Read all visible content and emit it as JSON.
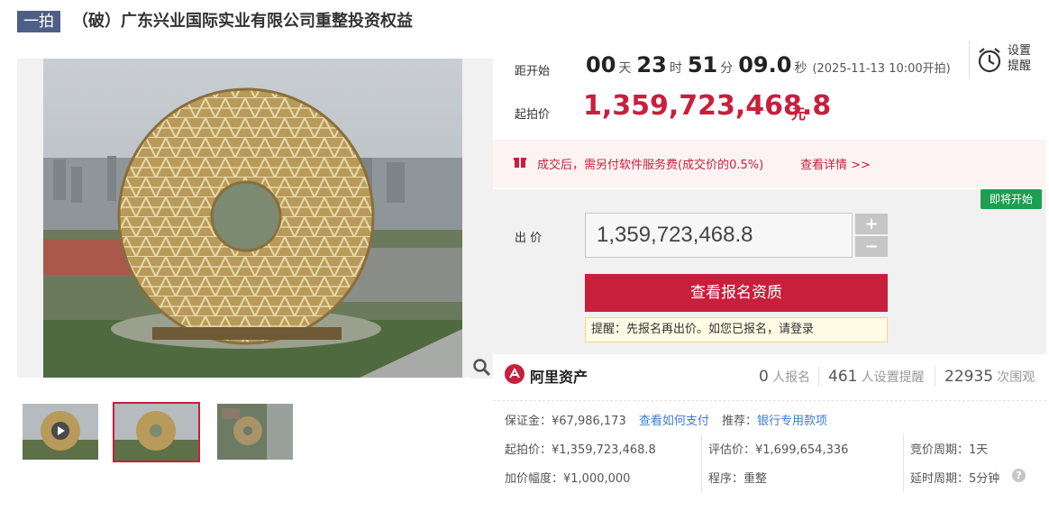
{
  "header": {
    "tag": "一拍",
    "title": "（破）广东兴业国际实业有限公司重整投资权益"
  },
  "countdown": {
    "label": "距开始",
    "days": "00",
    "days_unit": "天",
    "hours": "23",
    "hours_unit": "时",
    "minutes": "51",
    "minutes_unit": "分",
    "seconds": "09.0",
    "seconds_unit": "秒",
    "start_note": "(2025-11-13 10:00开拍)"
  },
  "reminder": {
    "label": "设置提醒"
  },
  "start_price": {
    "label": "起拍价",
    "value": "1,359,723,468.8",
    "unit": "元"
  },
  "notice": {
    "text": "成交后，需另付软件服务费(成交价的0.5%)",
    "link": "查看详情 >>"
  },
  "bid": {
    "badge": "即将开始",
    "label": "出 价",
    "value": "1,359,723,468.8",
    "plus": "+",
    "minus": "−",
    "signup_button": "查看报名资质",
    "tip": "提醒：先报名再出价。如您已报名，请登录"
  },
  "platform": {
    "name": "阿里资产"
  },
  "stats": [
    {
      "num": "0",
      "label": "人报名"
    },
    {
      "num": "461",
      "label": "人设置提醒"
    },
    {
      "num": "22935",
      "label": "次围观"
    }
  ],
  "details": {
    "deposit_label": "保证金：",
    "deposit_value": "¥67,986,173",
    "deposit_link": "查看如何支付",
    "recommend_label": "推荐：",
    "recommend_link": "银行专用款项",
    "start_price_text": "起拍价：¥1,359,723,468.8",
    "appraisal_text": "评估价：¥1,699,654,336",
    "cycle_text": "竞价周期：1天",
    "increment_text": "加价幅度：¥1,000,000",
    "procedure_text": "程序：重整",
    "extension_text": "延时周期：5分钟"
  },
  "colors": {
    "accent_red": "#c81f3c",
    "badge_green": "#1e9e50",
    "tag_blue": "#4d5f86",
    "link_blue": "#3a7bd5"
  },
  "icons": [
    "search-zoom-icon",
    "play-icon",
    "alarm-clock-icon",
    "gift-icon",
    "ali-logo-icon",
    "help-icon"
  ]
}
